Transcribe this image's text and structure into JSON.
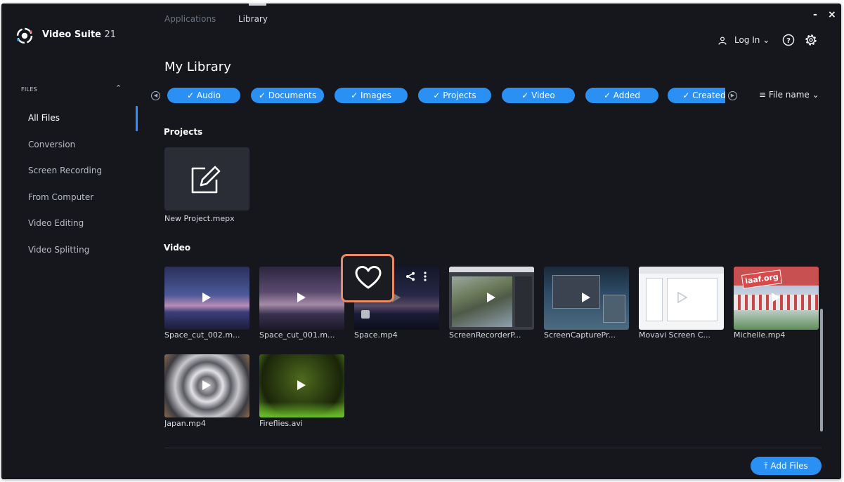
{
  "app": {
    "name": "Video Suite",
    "version": "21"
  },
  "top_tabs": [
    {
      "label": "Applications",
      "active": false
    },
    {
      "label": "Library",
      "active": true
    }
  ],
  "window_controls": {
    "minimize": "-",
    "close": "×"
  },
  "header": {
    "login_label": "Log In",
    "help_icon": "help-circle-icon",
    "settings_icon": "gear-icon"
  },
  "sidebar": {
    "section_label": "FILES",
    "items": [
      {
        "label": "All Files",
        "active": true
      },
      {
        "label": "Conversion",
        "active": false
      },
      {
        "label": "Screen Recording",
        "active": false
      },
      {
        "label": "From Computer",
        "active": false
      },
      {
        "label": "Video Editing",
        "active": false
      },
      {
        "label": "Video Splitting",
        "active": false
      }
    ]
  },
  "page_title": "My Library",
  "filters": [
    "✓ Audio",
    "✓ Documents",
    "✓ Images",
    "✓ Projects",
    "✓ Video",
    "✓ Added",
    "✓ Created"
  ],
  "sort_label": "File name",
  "sections": {
    "projects_title": "Projects",
    "video_title": "Video"
  },
  "projects": [
    {
      "name": "New Project.mepx"
    }
  ],
  "videos": [
    {
      "name": "Space_cut_002.m..."
    },
    {
      "name": "Space_cut_001.m..."
    },
    {
      "name": "Space.mp4"
    },
    {
      "name": "ScreenRecorderP..."
    },
    {
      "name": "ScreenCapturePr..."
    },
    {
      "name": "Movavi Screen C..."
    },
    {
      "name": "Michelle.mp4"
    },
    {
      "name": "Japan.mp4"
    },
    {
      "name": "Fireflies.avi"
    }
  ],
  "thumbnail_text": {
    "michelle_banner": "iaaf.org"
  },
  "add_files_label": "Add Files",
  "colors": {
    "background": "#15171c",
    "accent": "#2a90f4",
    "highlight": "#ec8a64"
  }
}
